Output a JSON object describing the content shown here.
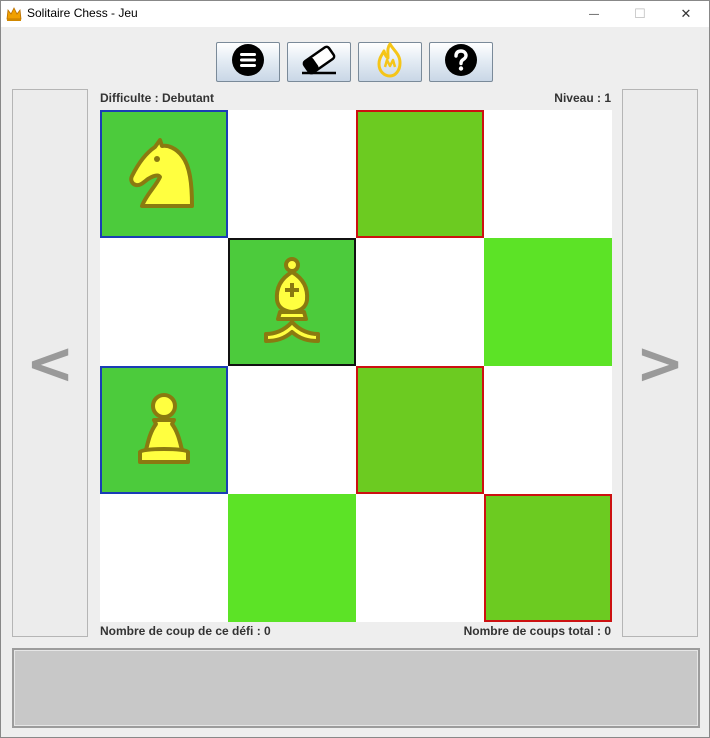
{
  "window": {
    "title": "Solitaire Chess - Jeu",
    "controls": {
      "minimize": "—",
      "maximize": "☐",
      "close": "✕"
    }
  },
  "toolbar": {
    "buttons": [
      {
        "name": "menu-button",
        "icon": "menu-icon"
      },
      {
        "name": "erase-button",
        "icon": "eraser-icon"
      },
      {
        "name": "hint-button",
        "icon": "flame-icon"
      },
      {
        "name": "help-button",
        "icon": "help-icon"
      }
    ]
  },
  "navigation": {
    "previous": "<",
    "next": ">"
  },
  "info": {
    "difficulty": "Difficulte : Debutant",
    "level": "Niveau : 1",
    "moves_challenge": "Nombre de coup de ce défi : 0",
    "moves_total": "Nombre de coups total : 0"
  },
  "board": {
    "rows": 4,
    "cols": 4,
    "colors": {
      "white": "#ffffff",
      "green": "#5ce326",
      "selected_green": "#4ccb3c",
      "target_green": "#6ccb21",
      "blue_border": "#1a3db5",
      "red_border": "#cc1111",
      "black_border": "#111111",
      "piece_fill": "#ffff40",
      "piece_outline": "#8a7a10"
    },
    "cells": [
      {
        "row": 0,
        "col": 0,
        "state": "piece",
        "piece": "knight",
        "border": "blue"
      },
      {
        "row": 0,
        "col": 2,
        "state": "target",
        "piece": "",
        "border": "red"
      },
      {
        "row": 1,
        "col": 1,
        "state": "selected",
        "piece": "bishop",
        "border": "black"
      },
      {
        "row": 1,
        "col": 3,
        "state": "green",
        "piece": "",
        "border": ""
      },
      {
        "row": 2,
        "col": 0,
        "state": "piece",
        "piece": "pawn",
        "border": "blue"
      },
      {
        "row": 2,
        "col": 2,
        "state": "target",
        "piece": "",
        "border": "red"
      },
      {
        "row": 3,
        "col": 1,
        "state": "green",
        "piece": "",
        "border": ""
      },
      {
        "row": 3,
        "col": 3,
        "state": "target",
        "piece": "",
        "border": "red"
      }
    ]
  },
  "status": {
    "message": ""
  }
}
